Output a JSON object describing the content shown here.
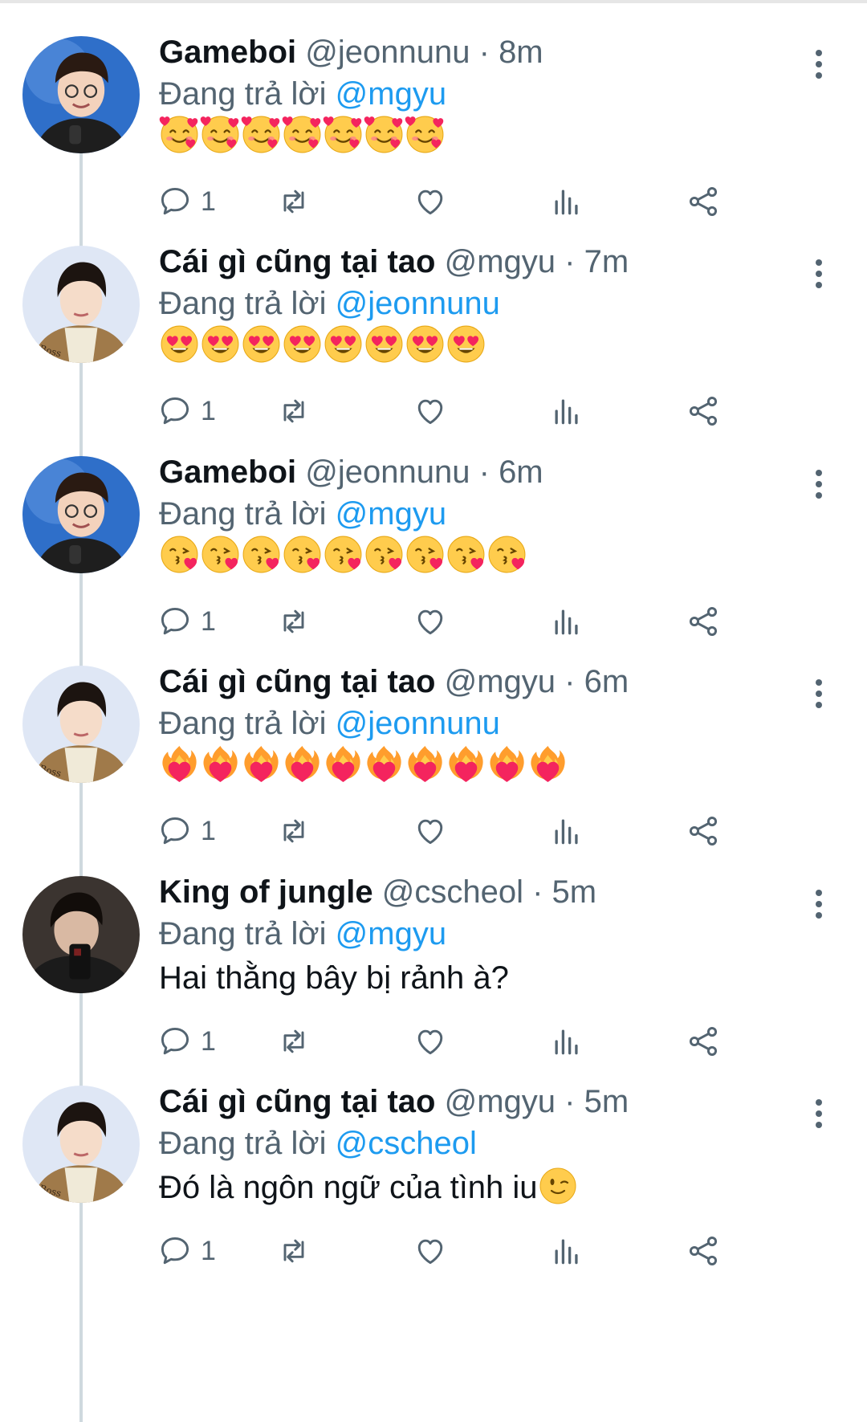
{
  "reply_prefix": "Đang trả lời",
  "tweets": [
    {
      "name": "Gameboi",
      "handle": "@jeonnunu",
      "time": "8m",
      "reply_to": "@mgyu",
      "emoji_name": "smiling-face-with-hearts",
      "emoji_count": 7,
      "replies": "1",
      "avatar": "gameboi"
    },
    {
      "name": "Cái gì cũng tại tao",
      "handle": "@mgyu",
      "time": "7m",
      "reply_to": "@jeonnunu",
      "emoji_name": "heart-eyes",
      "emoji_count": 8,
      "replies": "1",
      "avatar": "mgyu"
    },
    {
      "name": "Gameboi",
      "handle": "@jeonnunu",
      "time": "6m",
      "reply_to": "@mgyu",
      "emoji_name": "face-blowing-kiss",
      "emoji_count": 9,
      "replies": "1",
      "avatar": "gameboi"
    },
    {
      "name": "Cái gì cũng tại tao",
      "handle": "@mgyu",
      "time": "6m",
      "reply_to": "@jeonnunu",
      "emoji_name": "heart-on-fire",
      "emoji_count": 10,
      "replies": "1",
      "avatar": "mgyu"
    },
    {
      "name": "King of jungle",
      "handle": "@cscheol",
      "time": "5m",
      "reply_to": "@mgyu",
      "text": "Hai thằng bây bị rảnh à?",
      "replies": "1",
      "avatar": "cscheol"
    },
    {
      "name": "Cái gì cũng tại tao",
      "handle": "@mgyu",
      "time": "5m",
      "reply_to": "@cscheol",
      "text": "Đó là ngôn ngữ của tình iu",
      "trailing_emoji": "winking-face",
      "replies": "1",
      "avatar": "mgyu"
    }
  ],
  "colors": {
    "link": "#1d9bf0",
    "secondary": "#536471",
    "thread_line": "#cfd9de"
  }
}
